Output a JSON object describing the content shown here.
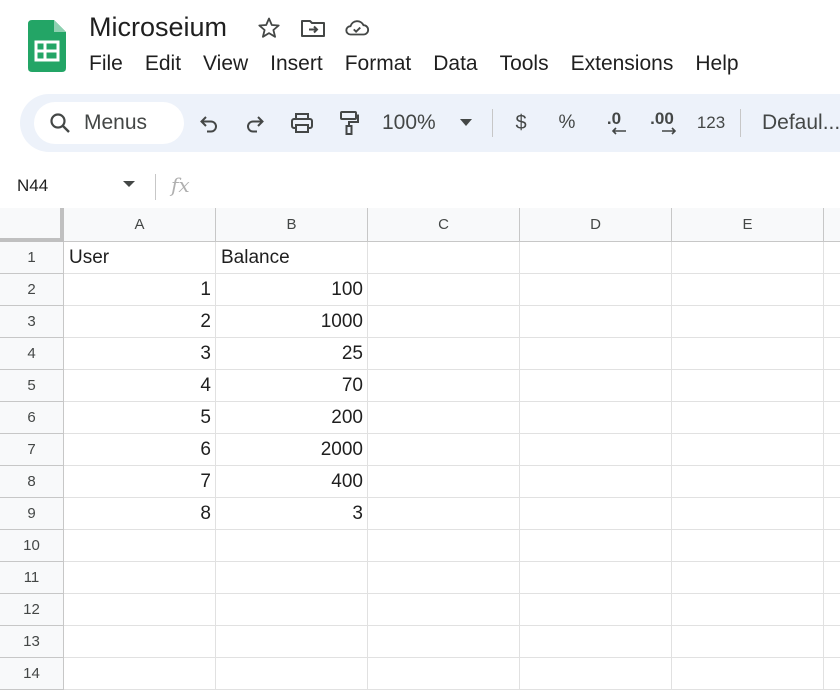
{
  "title": "Microseium",
  "menus": [
    "File",
    "Edit",
    "View",
    "Insert",
    "Format",
    "Data",
    "Tools",
    "Extensions",
    "Help"
  ],
  "toolbar": {
    "search_label": "Menus",
    "zoom": "100%",
    "currency": "$",
    "percent": "%",
    "decrease_decimal": ".0",
    "increase_decimal": ".00",
    "number_format": "123",
    "font": "Defaul..."
  },
  "formula_bar": {
    "cell_ref": "N44",
    "fx": "fx",
    "value": ""
  },
  "columns": [
    "A",
    "B",
    "C",
    "D",
    "E"
  ],
  "row_numbers": [
    "1",
    "2",
    "3",
    "4",
    "5",
    "6",
    "7",
    "8",
    "9",
    "10",
    "11",
    "12",
    "13",
    "14"
  ],
  "rows": [
    [
      "User",
      "Balance",
      "",
      "",
      ""
    ],
    [
      "1",
      "100",
      "",
      "",
      ""
    ],
    [
      "2",
      "1000",
      "",
      "",
      ""
    ],
    [
      "3",
      "25",
      "",
      "",
      ""
    ],
    [
      "4",
      "70",
      "",
      "",
      ""
    ],
    [
      "5",
      "200",
      "",
      "",
      ""
    ],
    [
      "6",
      "2000",
      "",
      "",
      ""
    ],
    [
      "7",
      "400",
      "",
      "",
      ""
    ],
    [
      "8",
      "3",
      "",
      "",
      ""
    ],
    [
      "",
      "",
      "",
      "",
      ""
    ],
    [
      "",
      "",
      "",
      "",
      ""
    ],
    [
      "",
      "",
      "",
      "",
      ""
    ],
    [
      "",
      "",
      "",
      "",
      ""
    ],
    [
      "",
      "",
      "",
      "",
      ""
    ]
  ],
  "colors": {
    "brand": "#23a566",
    "toolbar_bg": "#edf2fa",
    "header_bg": "#f8f9fa"
  }
}
